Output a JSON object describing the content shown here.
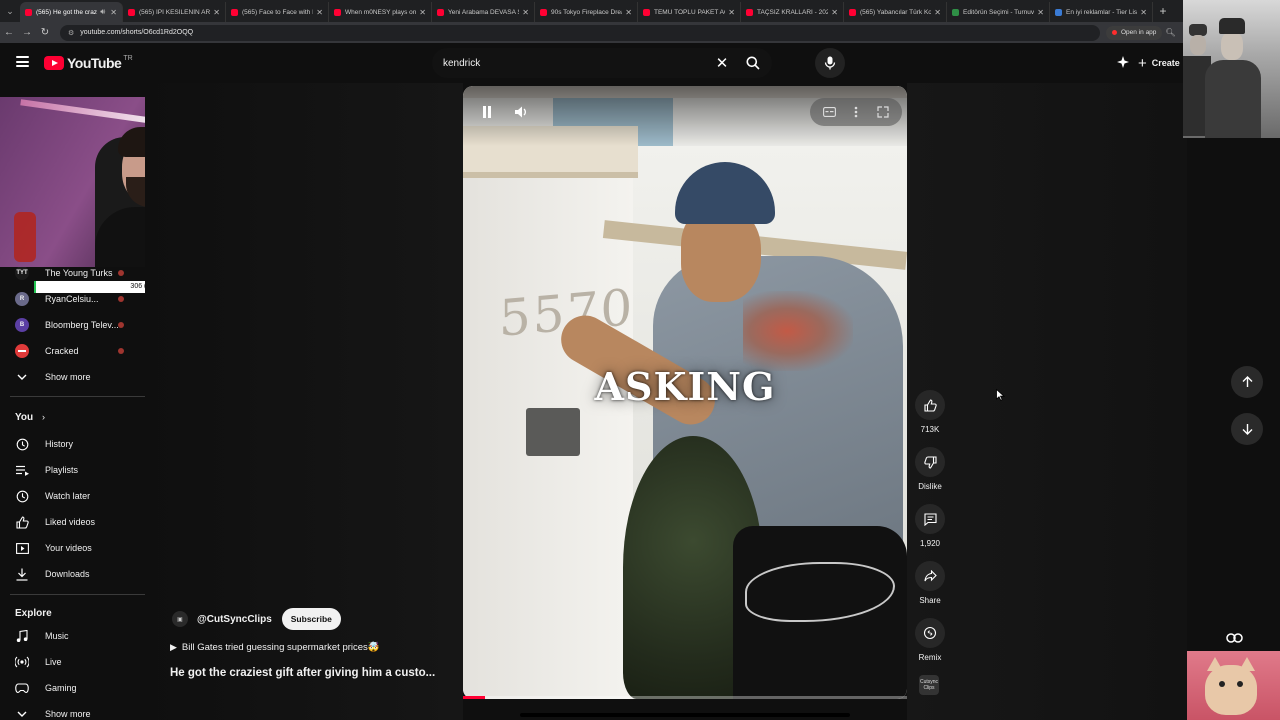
{
  "browser": {
    "tabs": [
      {
        "title": "(565) He got the crazi",
        "active": true
      },
      {
        "title": "(565) İPİ KESİLENİN ARAB",
        "active": false
      },
      {
        "title": "(565) Face to Face with In",
        "active": false
      },
      {
        "title": "When m0NESY plays on F",
        "active": false
      },
      {
        "title": "Yeni Arabama DEVASA SE",
        "active": false
      },
      {
        "title": "90s Tokyo Fireplace Drea",
        "active": false
      },
      {
        "title": "TEMU TOPLU PAKET AÇILI",
        "active": false
      },
      {
        "title": "TAÇSIZ KRALLARI - 2025 Y",
        "active": false
      },
      {
        "title": "(565) Yabancılar Türk Kori",
        "active": false
      },
      {
        "title": "Editörün Seçimi - Turnuva",
        "active": false
      },
      {
        "title": "En iyi reklamlar - Tier List",
        "active": false
      }
    ],
    "url": "youtube.com/shorts/O6cd1Rd2OQQ",
    "open_in_app": "Open in app"
  },
  "header": {
    "logo_text": "YouTube",
    "country_code": "TR",
    "search_value": "kendrick",
    "create_label": "Create"
  },
  "overlay": {
    "sub_count": "306 (0.86%)",
    "sub_progress": 0.0086
  },
  "sidebar": {
    "subscriptions": [
      {
        "name": "The Young Turks",
        "avatar": "TYT",
        "color": "#1a1a1a"
      },
      {
        "name": "RyanCelsiu...",
        "avatar": "R",
        "color": "#6a6a8a"
      },
      {
        "name": "Bloomberg Telev...",
        "avatar": "B",
        "color": "#5b3fa3"
      },
      {
        "name": "Cracked",
        "avatar": "",
        "color": "#e03a3a"
      }
    ],
    "show_more_1": "Show more",
    "you_title": "You",
    "you_items": [
      {
        "label": "History",
        "icon": "history-icon"
      },
      {
        "label": "Playlists",
        "icon": "playlists-icon"
      },
      {
        "label": "Watch later",
        "icon": "watch-later-icon"
      },
      {
        "label": "Liked videos",
        "icon": "like-icon"
      },
      {
        "label": "Your videos",
        "icon": "your-videos-icon"
      },
      {
        "label": "Downloads",
        "icon": "download-icon"
      }
    ],
    "explore_title": "Explore",
    "explore_items": [
      {
        "label": "Music",
        "icon": "music-icon"
      },
      {
        "label": "Live",
        "icon": "live-icon"
      },
      {
        "label": "Gaming",
        "icon": "gaming-icon"
      }
    ],
    "show_more_2": "Show more"
  },
  "short": {
    "overlay_text": "ASKING",
    "house_number": "5570",
    "channel_handle": "@CutSyncClips",
    "subscribe_label": "Subscribe",
    "description": "Bill Gates tried guessing supermarket prices🤯",
    "title": "He got the craziest gift after giving him a custo...",
    "progress": 0.05,
    "remix_thumb_text": "Cutsync Clips"
  },
  "actions": {
    "likes": "713K",
    "dislike_label": "Dislike",
    "comments": "1,920",
    "share_label": "Share",
    "remix_label": "Remix"
  },
  "colors": {
    "brand_red": "#ff0033",
    "background": "#0f0f0f"
  }
}
